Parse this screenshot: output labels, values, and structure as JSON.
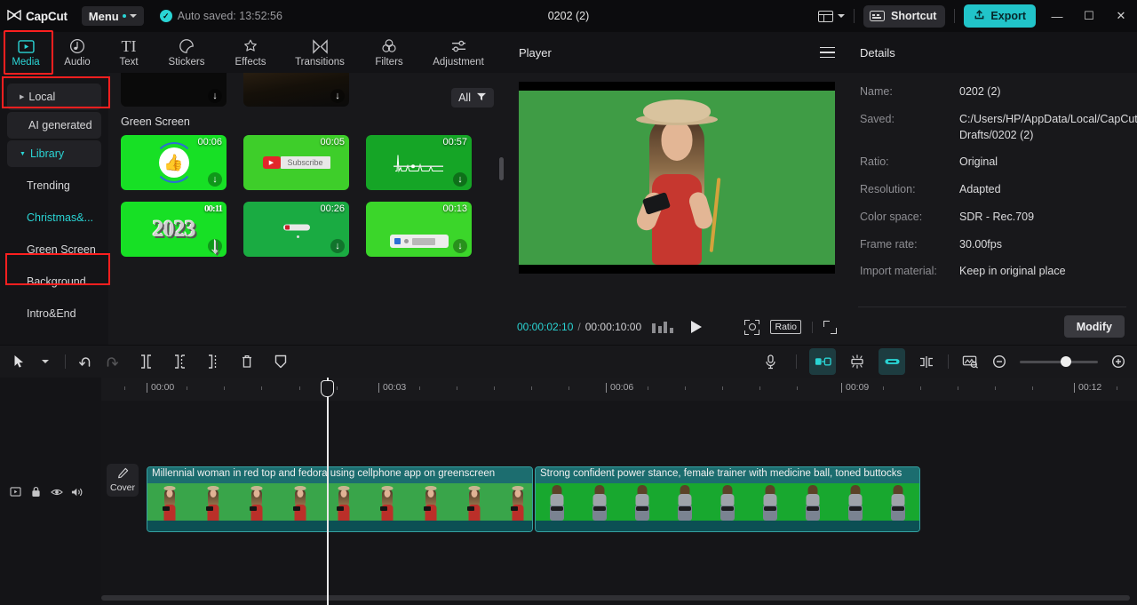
{
  "titlebar": {
    "app_name": "CapCut",
    "menu_label": "Menu",
    "autosave": "Auto saved: 13:52:56",
    "project_title": "0202 (2)",
    "shortcut_label": "Shortcut",
    "export_label": "Export",
    "minimize": "—",
    "maximize": "☐",
    "close": "✕"
  },
  "function_tabs": [
    {
      "label": "Media",
      "icon": "media-icon",
      "active": true
    },
    {
      "label": "Audio",
      "icon": "audio-icon",
      "active": false
    },
    {
      "label": "Text",
      "icon": "text-icon",
      "active": false
    },
    {
      "label": "Stickers",
      "icon": "stickers-icon",
      "active": false
    },
    {
      "label": "Effects",
      "icon": "effects-icon",
      "active": false
    },
    {
      "label": "Transitions",
      "icon": "transitions-icon",
      "active": false
    },
    {
      "label": "Filters",
      "icon": "filters-icon",
      "active": false
    },
    {
      "label": "Adjustment",
      "icon": "adjustment-icon",
      "active": false
    }
  ],
  "library_nav": {
    "items": [
      {
        "label": "Local",
        "type": "collapsible",
        "highlighted": false
      },
      {
        "label": "AI generated",
        "type": "plain",
        "highlighted": false
      },
      {
        "label": "Library",
        "type": "collapsible",
        "highlighted": true
      },
      {
        "label": "Trending",
        "type": "sub",
        "highlighted": false
      },
      {
        "label": "Christmas&...",
        "type": "sub",
        "highlighted": false
      },
      {
        "label": "Green Screen",
        "type": "sub",
        "highlighted": true
      },
      {
        "label": "Background",
        "type": "sub",
        "highlighted": false
      },
      {
        "label": "Intro&End",
        "type": "sub",
        "highlighted": false
      }
    ]
  },
  "media_panel": {
    "filter_label": "All",
    "section_title": "Green Screen",
    "partial_row": [
      {
        "art": "dark"
      },
      {
        "art": "dark2"
      }
    ],
    "thumbnails": [
      {
        "duration": "00:06",
        "art": "like"
      },
      {
        "duration": "00:05",
        "art": "sub",
        "sub_label": "Subscribe"
      },
      {
        "duration": "00:57",
        "art": "wave"
      },
      {
        "duration": "00:11",
        "art": "2023",
        "text": "2023"
      },
      {
        "duration": "00:26",
        "art": "car"
      },
      {
        "duration": "00:13",
        "art": "bar"
      }
    ]
  },
  "player": {
    "title": "Player",
    "current_time": "00:00:02:10",
    "total_time": "00:00:10:00",
    "time_separator": "/",
    "ratio_label": "Ratio"
  },
  "details": {
    "title": "Details",
    "rows": [
      {
        "key": "Name:",
        "value": "0202 (2)"
      },
      {
        "key": "Saved:",
        "value": "C:/Users/HP/AppData/Local/CapCut Drafts/0202 (2)"
      },
      {
        "key": "Ratio:",
        "value": "Original"
      },
      {
        "key": "Resolution:",
        "value": "Adapted"
      },
      {
        "key": "Color space:",
        "value": "SDR - Rec.709"
      },
      {
        "key": "Frame rate:",
        "value": "30.00fps"
      },
      {
        "key": "Import material:",
        "value": "Keep in original place"
      }
    ],
    "modify_label": "Modify"
  },
  "timeline_toolbar": {
    "tools": [
      {
        "name": "select-tool",
        "enabled": true
      },
      {
        "name": "tool-dropdown",
        "enabled": true
      },
      {
        "name": "undo",
        "enabled": true
      },
      {
        "name": "redo",
        "enabled": false
      },
      {
        "name": "split",
        "enabled": true
      },
      {
        "name": "trim-left",
        "enabled": true
      },
      {
        "name": "trim-right",
        "enabled": true
      },
      {
        "name": "delete",
        "enabled": true
      },
      {
        "name": "freeze",
        "enabled": true
      },
      {
        "name": "record",
        "enabled": true
      },
      {
        "name": "auto-fill",
        "enabled": true,
        "toggled": true
      },
      {
        "name": "mirror",
        "enabled": true
      },
      {
        "name": "link",
        "enabled": true,
        "toggled": true
      },
      {
        "name": "cut-all",
        "enabled": true
      },
      {
        "name": "preview-frame",
        "enabled": true
      },
      {
        "name": "zoom-out",
        "enabled": true
      },
      {
        "name": "zoom-in",
        "enabled": true
      }
    ]
  },
  "timeline": {
    "ruler_ticks": [
      "00:00",
      "00:03",
      "00:06",
      "00:09",
      "00:12"
    ],
    "cover_label": "Cover",
    "track_icons": [
      "track-type-icon",
      "lock-icon",
      "eye-icon",
      "volume-icon"
    ],
    "clips": [
      {
        "label": "Millennial woman in red top and fedora using cellphone app on greenscreen",
        "art": "woman-phone",
        "frames": 9
      },
      {
        "label": "Strong confident power stance, female trainer with medicine ball, toned buttocks",
        "art": "trainer",
        "frames": 9
      }
    ]
  },
  "colors": {
    "accent": "#2ad4d4",
    "export": "#21c4c9",
    "highlight": "#ff1f1f",
    "clip": "#0f5a5e"
  }
}
